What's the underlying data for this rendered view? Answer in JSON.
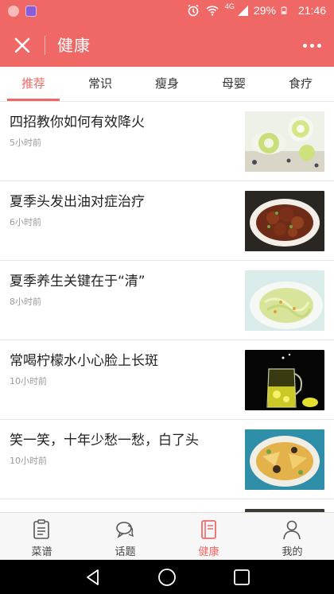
{
  "status_bar": {
    "network": "4G",
    "battery": "29%",
    "time": "21:46",
    "icons": [
      "notification-icon",
      "app-icon",
      "alarm-icon",
      "wifi-icon",
      "signal-icon",
      "battery-icon"
    ]
  },
  "header": {
    "title": "健康",
    "close_icon": "close-icon",
    "more_icon": "more-icon"
  },
  "tabs": [
    {
      "label": "推荐",
      "active": true
    },
    {
      "label": "常识",
      "active": false
    },
    {
      "label": "瘦身",
      "active": false
    },
    {
      "label": "母婴",
      "active": false
    },
    {
      "label": "食疗",
      "active": false
    }
  ],
  "articles": [
    {
      "title": "四招教你如何有效降火",
      "time": "5小时前"
    },
    {
      "title": "夏季头发出油对症治疗",
      "time": "6小时前"
    },
    {
      "title": "夏季养生关键在于“清”",
      "time": "8小时前"
    },
    {
      "title": "常喝柠檬水小心脸上长斑",
      "time": "10小时前"
    },
    {
      "title": "笑一笑，十年少愁一愁，白了头",
      "time": "10小时前"
    }
  ],
  "bottom_nav": [
    {
      "label": "菜谱",
      "icon": "recipe-icon",
      "active": false
    },
    {
      "label": "话题",
      "icon": "topic-icon",
      "active": false
    },
    {
      "label": "健康",
      "icon": "health-book-icon",
      "active": true
    },
    {
      "label": "我的",
      "icon": "profile-icon",
      "active": false
    }
  ],
  "colors": {
    "accent": "#f06866",
    "text": "#222222",
    "muted": "#9a9a9a"
  }
}
